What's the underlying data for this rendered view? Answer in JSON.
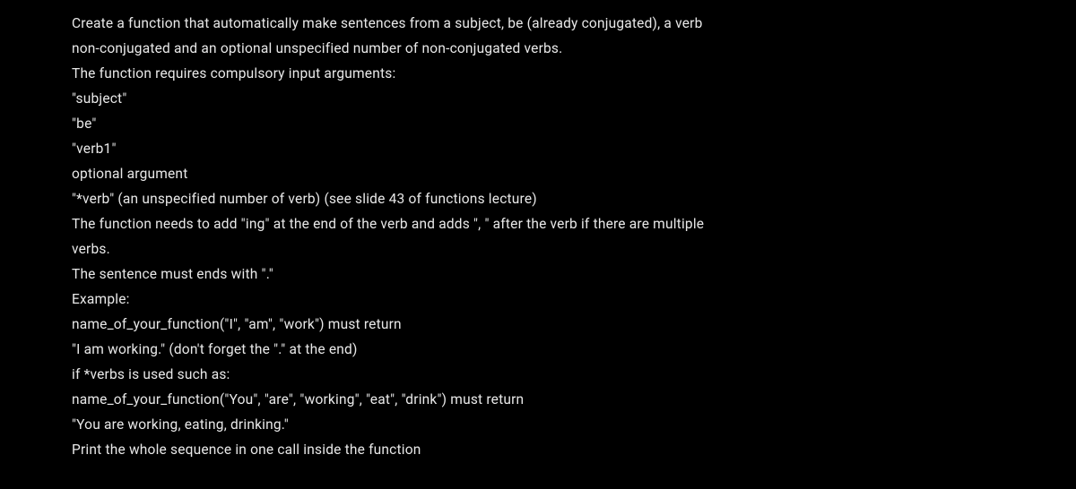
{
  "lines": [
    "Create a function that automatically make sentences from a subject, be (already conjugated), a verb",
    "non-conjugated and an optional unspecified number of non-conjugated verbs.",
    "The function requires compulsory input arguments:",
    "\"subject\"",
    "\"be\"",
    "\"verb1\"",
    "optional argument",
    "\"*verb\" (an unspecified number of verb) (see slide 43 of functions lecture)",
    "The function needs to add \"ing\" at the end of the verb and adds \", \" after the verb if there are multiple",
    "verbs.",
    "The sentence must ends with \".\"",
    "Example:",
    "name_of_your_function(\"I\", \"am\", \"work\") must return",
    "\"I am working.\" (don't forget the \".\" at the end)",
    "if *verbs is used such as:",
    "name_of_your_function(\"You\", \"are\", \"working\", \"eat\", \"drink\") must return",
    "\"You are working, eating, drinking.\"",
    "Print the whole sequence in one call inside the function"
  ]
}
